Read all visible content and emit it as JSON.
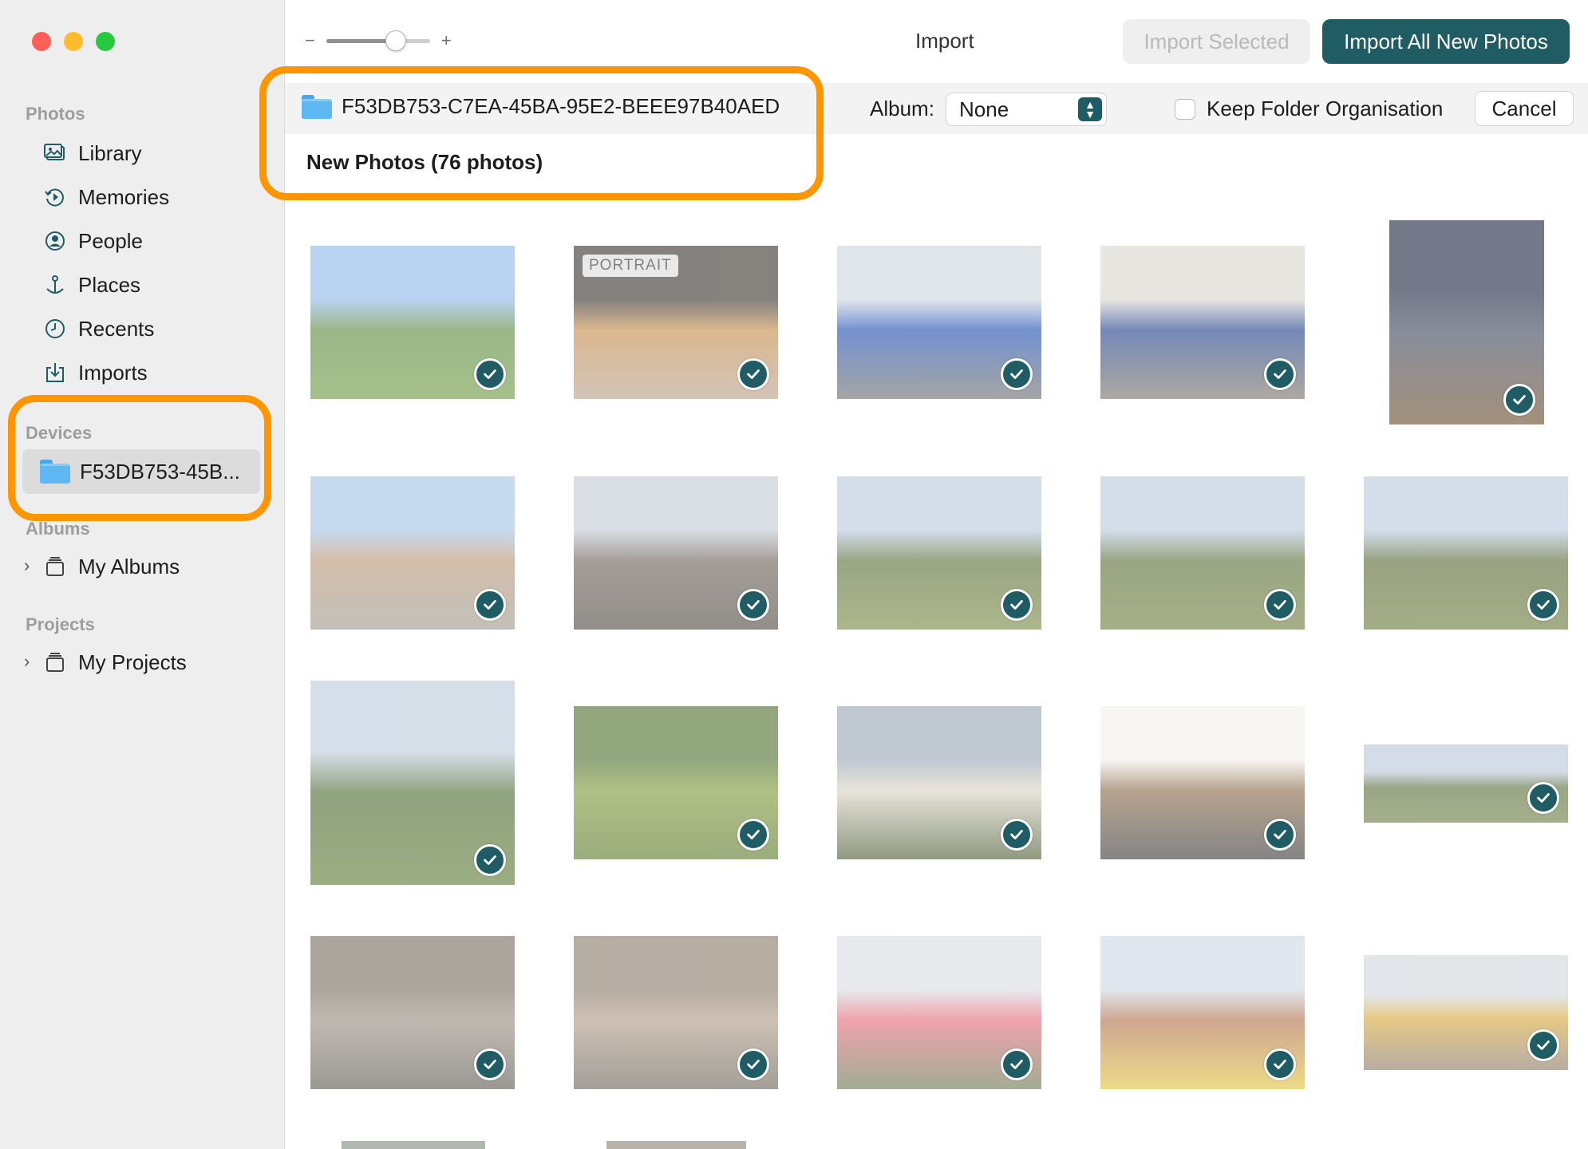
{
  "window": {
    "title": "Import",
    "traffic_colors": [
      "#ff5f57",
      "#febc2e",
      "#28c840"
    ]
  },
  "sidebar": {
    "sections": {
      "photos": "Photos",
      "devices": "Devices",
      "albums": "Albums",
      "projects": "Projects"
    },
    "items": [
      {
        "label": "Library",
        "icon": "library-icon"
      },
      {
        "label": "Memories",
        "icon": "memories-icon"
      },
      {
        "label": "People",
        "icon": "people-icon"
      },
      {
        "label": "Places",
        "icon": "places-icon"
      },
      {
        "label": "Recents",
        "icon": "recents-icon"
      },
      {
        "label": "Imports",
        "icon": "imports-icon"
      }
    ],
    "device": {
      "label": "F53DB753-45B...",
      "icon": "folder-icon"
    },
    "albums_item": "My Albums",
    "projects_item": "My Projects"
  },
  "toolbar": {
    "zoom_minus": "−",
    "zoom_plus": "+",
    "zoom_level": 0.62,
    "import_selected": "Import Selected",
    "import_all": "Import All New Photos"
  },
  "source": {
    "name": "F53DB753-C7EA-45BA-95E2-BEEE97B40AED",
    "album_label": "Album:",
    "album_value": "None",
    "keep_folder": "Keep Folder Organisation",
    "cancel": "Cancel",
    "group_title": "New Photos (76 photos)"
  },
  "photos": [
    {
      "badge": "",
      "checked": true,
      "colors": [
        "#8fb6e8",
        "#5f8a3f",
        "#6e9a44"
      ]
    },
    {
      "badge": "PORTRAIT",
      "checked": true,
      "colors": [
        "#3a3530",
        "#c48b4a",
        "#b8a08a"
      ]
    },
    {
      "badge": "",
      "checked": true,
      "colors": [
        "#cfd6df",
        "#1e4fb4",
        "#6d6d6d"
      ]
    },
    {
      "badge": "",
      "checked": true,
      "colors": [
        "#d9d6cf",
        "#1f3f8a",
        "#7b7368"
      ]
    },
    {
      "badge": "",
      "checked": true,
      "colors": [
        "#1d2740",
        "#40485e",
        "#6b4c2a"
      ]
    },
    {
      "badge": "",
      "checked": true,
      "colors": [
        "#a6c4e6",
        "#b89474",
        "#9e9a8e"
      ]
    },
    {
      "badge": "",
      "checked": true,
      "colors": [
        "#c2cad4",
        "#6e6258",
        "#4e4a44"
      ]
    },
    {
      "badge": "",
      "checked": true,
      "colors": [
        "#b8c9de",
        "#5b6e39",
        "#7a8a45"
      ]
    },
    {
      "badge": "",
      "checked": true,
      "colors": [
        "#b8c9de",
        "#5b6e39",
        "#6f7e3b"
      ]
    },
    {
      "badge": "",
      "checked": true,
      "colors": [
        "#b8c9de",
        "#5a6a36",
        "#6b7a3a"
      ]
    },
    {
      "badge": "",
      "checked": true,
      "colors": [
        "#bccbdb",
        "#4c6a30",
        "#5e7c35"
      ]
    },
    {
      "badge": "",
      "checked": true,
      "colors": [
        "#4f7030",
        "#7e9a38",
        "#5e7a2e"
      ]
    },
    {
      "badge": "",
      "checked": true,
      "colors": [
        "#9aa6b6",
        "#d8d2c2",
        "#4b5a35"
      ]
    },
    {
      "badge": "",
      "checked": true,
      "colors": [
        "#f2f0ec",
        "#8a6a4a",
        "#3a3a3a"
      ]
    },
    {
      "badge": "",
      "checked": true,
      "colors": [
        "#b9c6d8",
        "#5c6f3c",
        "#6d7d44"
      ]
    },
    {
      "badge": "",
      "checked": true,
      "colors": [
        "#7a6e62",
        "#9a8e82",
        "#5e5a52"
      ]
    },
    {
      "badge": "",
      "checked": true,
      "colors": [
        "#8a7a6a",
        "#b09a88",
        "#6a6458"
      ]
    },
    {
      "badge": "",
      "checked": true,
      "colors": [
        "#d8dce2",
        "#e26a7a",
        "#6a7a52"
      ]
    },
    {
      "badge": "",
      "checked": true,
      "colors": [
        "#cfd8e4",
        "#b0704a",
        "#e2c440"
      ]
    },
    {
      "badge": "",
      "checked": true,
      "colors": [
        "#d2d6dc",
        "#d8a83a",
        "#8a7a6a"
      ]
    }
  ]
}
